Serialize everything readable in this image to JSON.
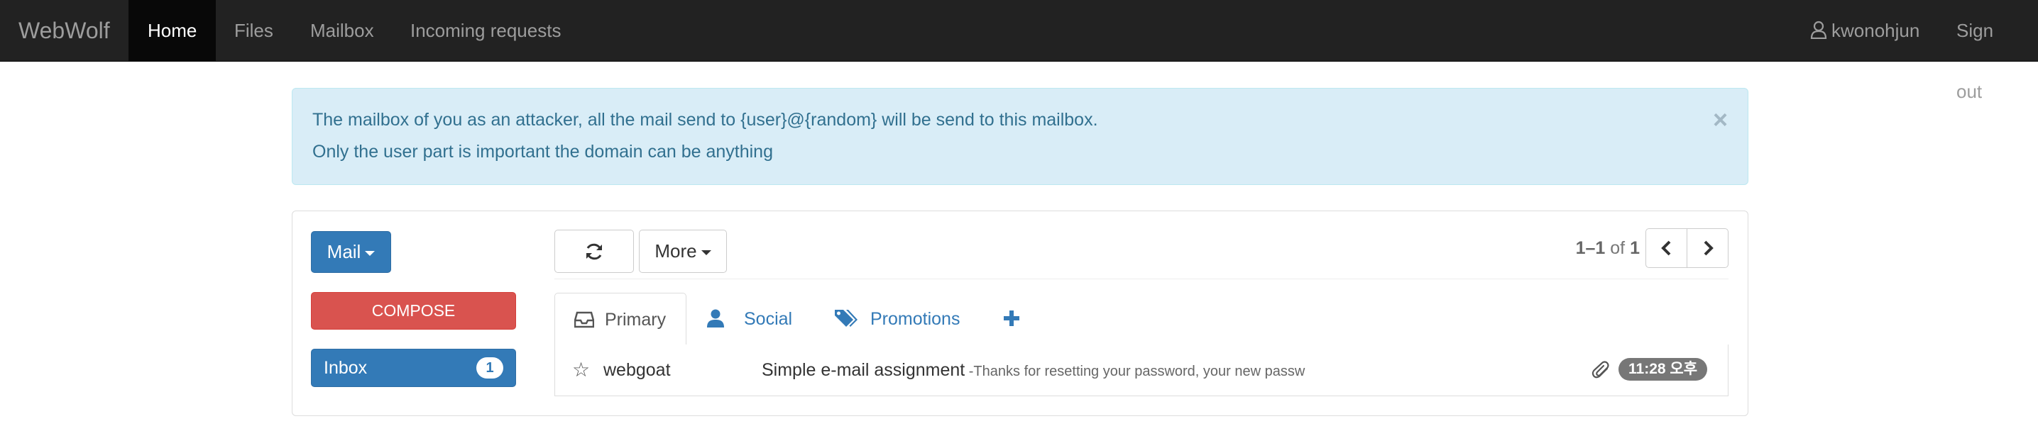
{
  "navbar": {
    "brand": "WebWolf",
    "items": [
      {
        "label": "Home",
        "active": true
      },
      {
        "label": "Files",
        "active": false
      },
      {
        "label": "Mailbox",
        "active": false
      },
      {
        "label": "Incoming requests",
        "active": false
      }
    ],
    "user": "kwonohjun",
    "sign_out": "Sign out"
  },
  "alert": {
    "line1": "The mailbox of you as an attacker, all the mail send to {user}@{random} will be send to this mailbox.",
    "line2": "Only the user part is important the domain can be anything",
    "close": "×"
  },
  "sidebar": {
    "mail_button": "Mail",
    "compose_button": "COMPOSE",
    "inbox": {
      "label": "Inbox",
      "count": "1"
    }
  },
  "toolbar": {
    "refresh_icon": "refresh-icon",
    "more_button": "More"
  },
  "pagination": {
    "range": "1–1",
    "of": "of",
    "total": "1"
  },
  "tabs": [
    {
      "label": "Primary",
      "icon": "inbox-icon",
      "active": true
    },
    {
      "label": "Social",
      "icon": "user-icon",
      "active": false
    },
    {
      "label": "Promotions",
      "icon": "tags-icon",
      "active": false
    },
    {
      "label": "+",
      "icon": "plus-icon",
      "active": false
    }
  ],
  "messages": [
    {
      "sender": "webgoat",
      "subject": "Simple e-mail assignment",
      "snippet": " -Thanks for resetting your password, your new passw",
      "time": "11:28 오후",
      "has_attachment": true,
      "starred": false
    }
  ],
  "colors": {
    "navbar_bg": "#222222",
    "primary": "#337ab7",
    "danger": "#d9534f",
    "info_bg": "#d9edf7",
    "info_text": "#31708f"
  }
}
